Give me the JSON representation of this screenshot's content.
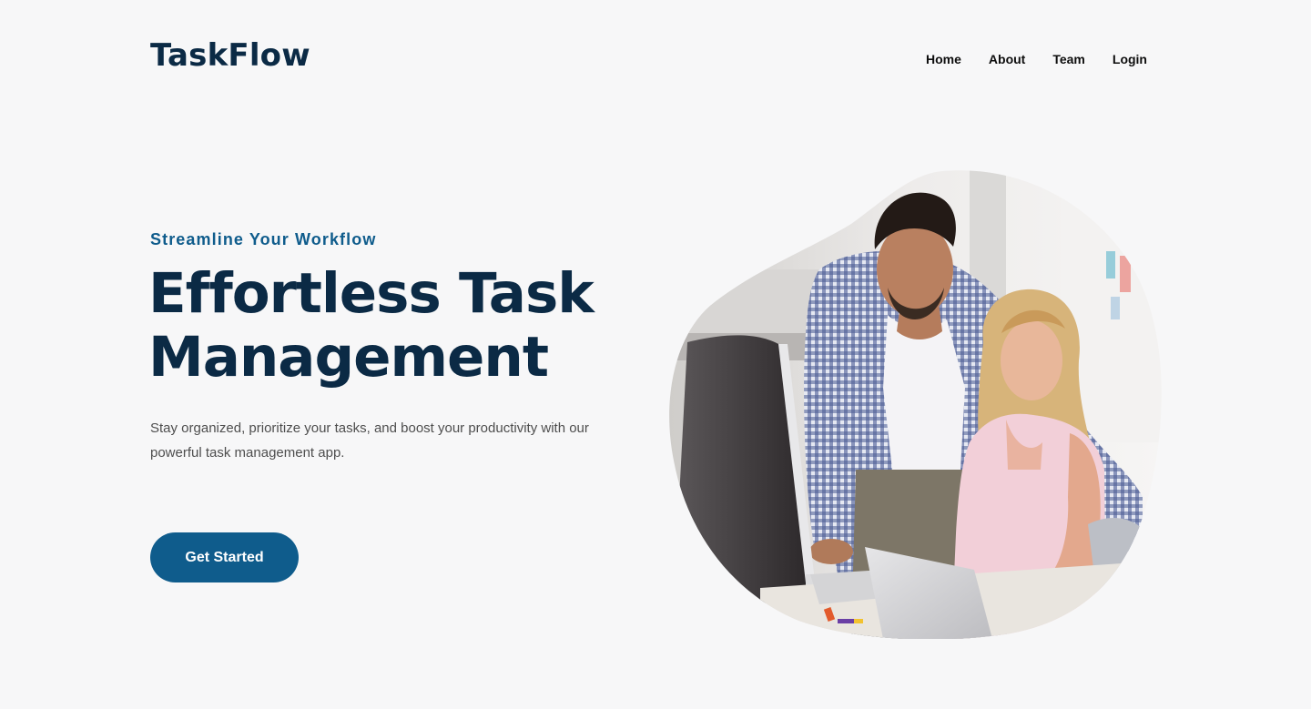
{
  "header": {
    "logo": "TaskFlow",
    "nav": [
      "Home",
      "About",
      "Team",
      "Login"
    ]
  },
  "hero": {
    "eyebrow": "Streamline Your Workflow",
    "headline_line1": "Effortless Task",
    "headline_line2": "Management",
    "description": "Stay organized, prioritize your tasks, and boost your productivity with our powerful task management app.",
    "cta_label": "Get Started"
  },
  "colors": {
    "background": "#f7f7f8",
    "primary": "#0f5c8c",
    "heading": "#0b2a45",
    "body_text": "#4e4e4e"
  }
}
